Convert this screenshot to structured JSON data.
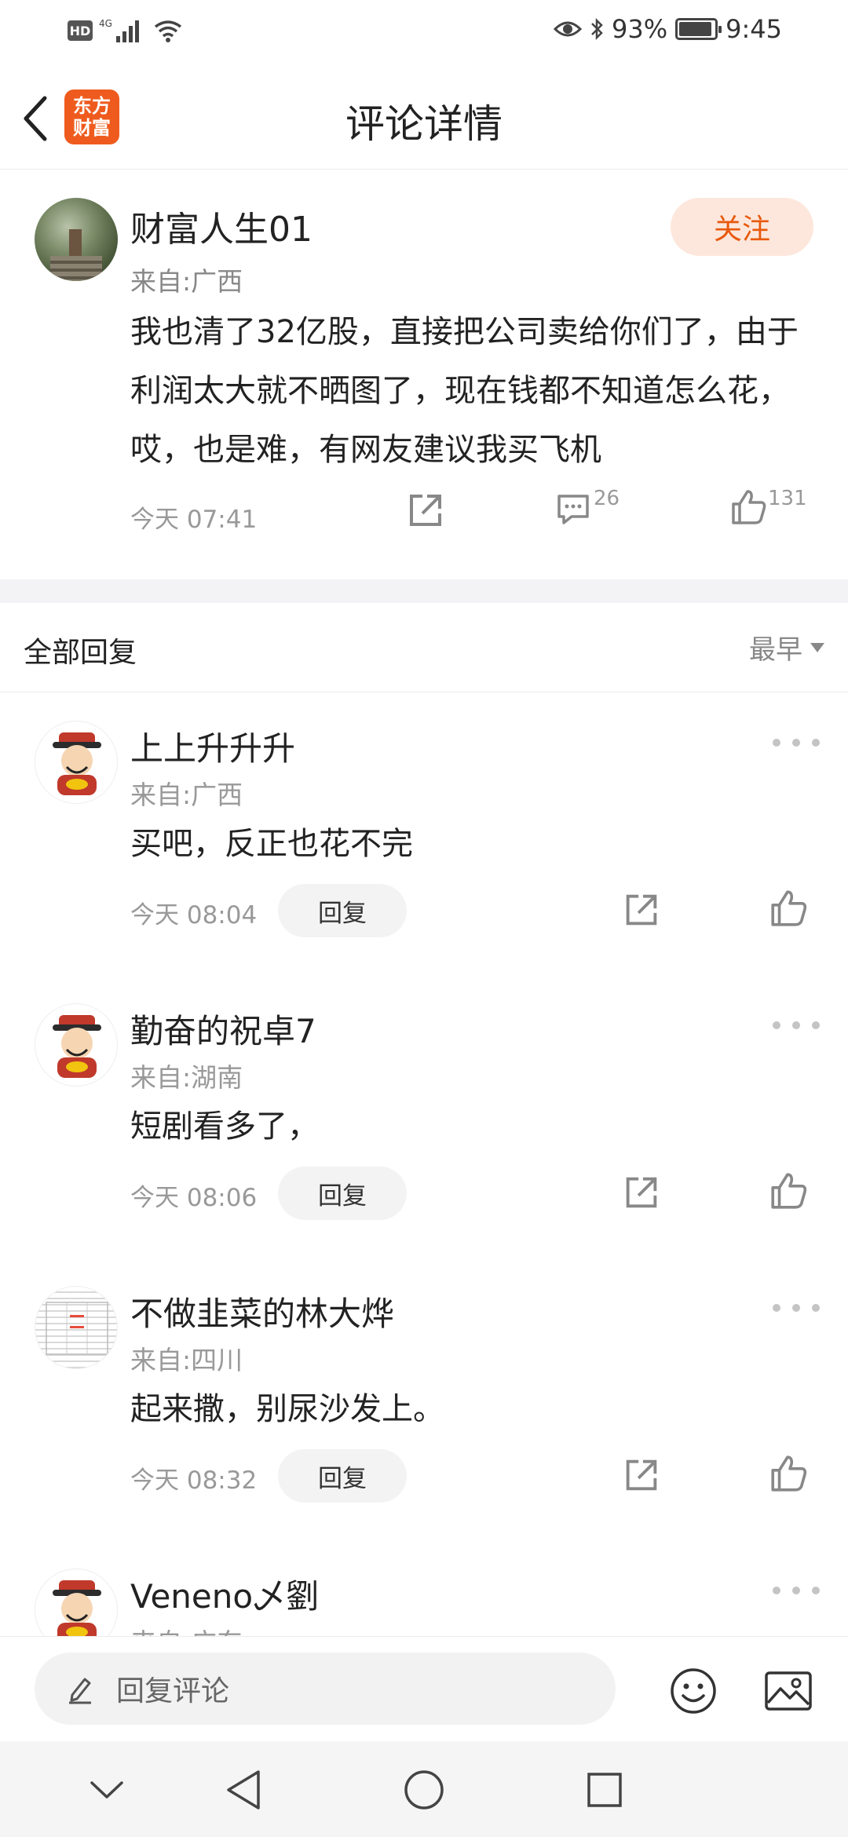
{
  "status_bar": {
    "hd": "HD",
    "network": "4G",
    "battery_percent": "93%",
    "battery_level": 0.93,
    "time": "9:45"
  },
  "header": {
    "logo_line1": "东方",
    "logo_line2": "财富",
    "title": "评论详情"
  },
  "post": {
    "username": "财富人生01",
    "location": "来自:广西",
    "follow_label": "关注",
    "text": "我也清了32亿股，直接把公司卖给你们了，由于利润太大就不晒图了，现在钱都不知道怎么花，哎，也是难，有网友建议我买飞机",
    "time": "今天 07:41",
    "comment_count": "26",
    "like_count": "131"
  },
  "replies_header": {
    "title": "全部回复",
    "sort_label": "最早"
  },
  "replies": [
    {
      "username": "上上升升升",
      "location": "来自:广西",
      "text": "买吧，反正也花不完",
      "time": "今天 08:04",
      "reply_label": "回复"
    },
    {
      "username": "勤奋的祝卓7",
      "location": "来自:湖南",
      "text": "短剧看多了，",
      "time": "今天 08:06",
      "reply_label": "回复"
    },
    {
      "username": "不做韭菜的林大烨",
      "location": "来自:四川",
      "text": "起来撒，别尿沙发上。",
      "time": "今天 08:32",
      "reply_label": "回复"
    },
    {
      "username": "Veneno乄劉",
      "location": "来自:广东",
      "text": "",
      "time": "",
      "reply_label": ""
    }
  ],
  "input_bar": {
    "placeholder": "回复评论"
  },
  "colors": {
    "accent": "#e8590c",
    "follow_bg": "#fde7dc",
    "logo_bg": "#ef5b1e"
  }
}
